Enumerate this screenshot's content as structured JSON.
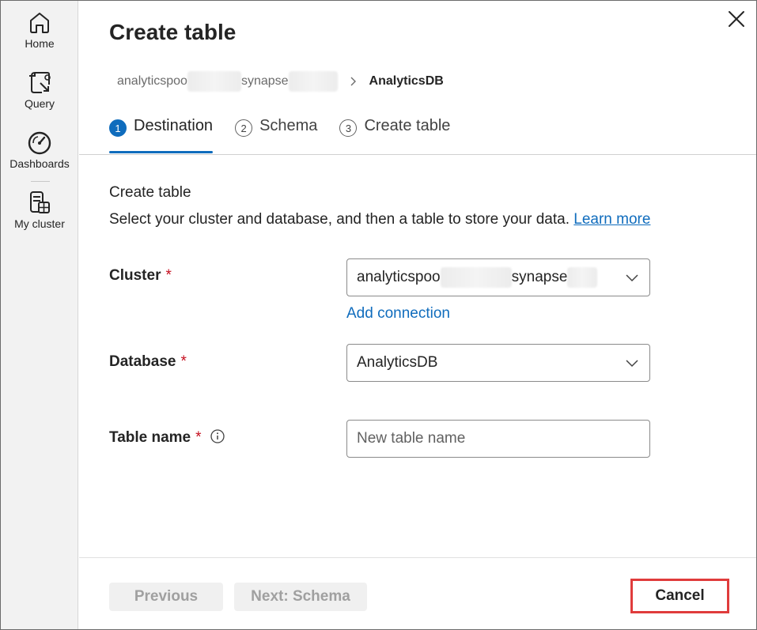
{
  "rail": {
    "items": [
      {
        "label": "Home",
        "icon": "home-icon"
      },
      {
        "label": "Query",
        "icon": "query-icon"
      },
      {
        "label": "Dashboards",
        "icon": "dashboard-gauge-icon"
      },
      {
        "label": "My cluster",
        "icon": "cluster-icon"
      }
    ]
  },
  "panel": {
    "title": "Create table",
    "breadcrumb": {
      "cluster_prefix": "analyticspoo",
      "cluster_suffix": "synapse",
      "current": "AnalyticsDB"
    },
    "steps": [
      {
        "num": "1",
        "label": "Destination",
        "active": true
      },
      {
        "num": "2",
        "label": "Schema",
        "active": false
      },
      {
        "num": "3",
        "label": "Create table",
        "active": false
      }
    ],
    "section": {
      "title": "Create table",
      "description": "Select your cluster and database, and then a table to store your data.",
      "learn_more": "Learn more"
    },
    "form": {
      "cluster_label": "Cluster",
      "cluster_value_prefix": "analyticspoo",
      "cluster_value_suffix": "synapse",
      "add_connection": "Add connection",
      "database_label": "Database",
      "database_value": "AnalyticsDB",
      "table_name_label": "Table name",
      "table_name_placeholder": "New table name",
      "required_mark": "*"
    },
    "footer": {
      "previous": "Previous",
      "next": "Next: Schema",
      "cancel": "Cancel"
    }
  },
  "colors": {
    "accent": "#0f6cbd",
    "required": "#c50f1f",
    "highlight_border": "#e03c3c"
  }
}
